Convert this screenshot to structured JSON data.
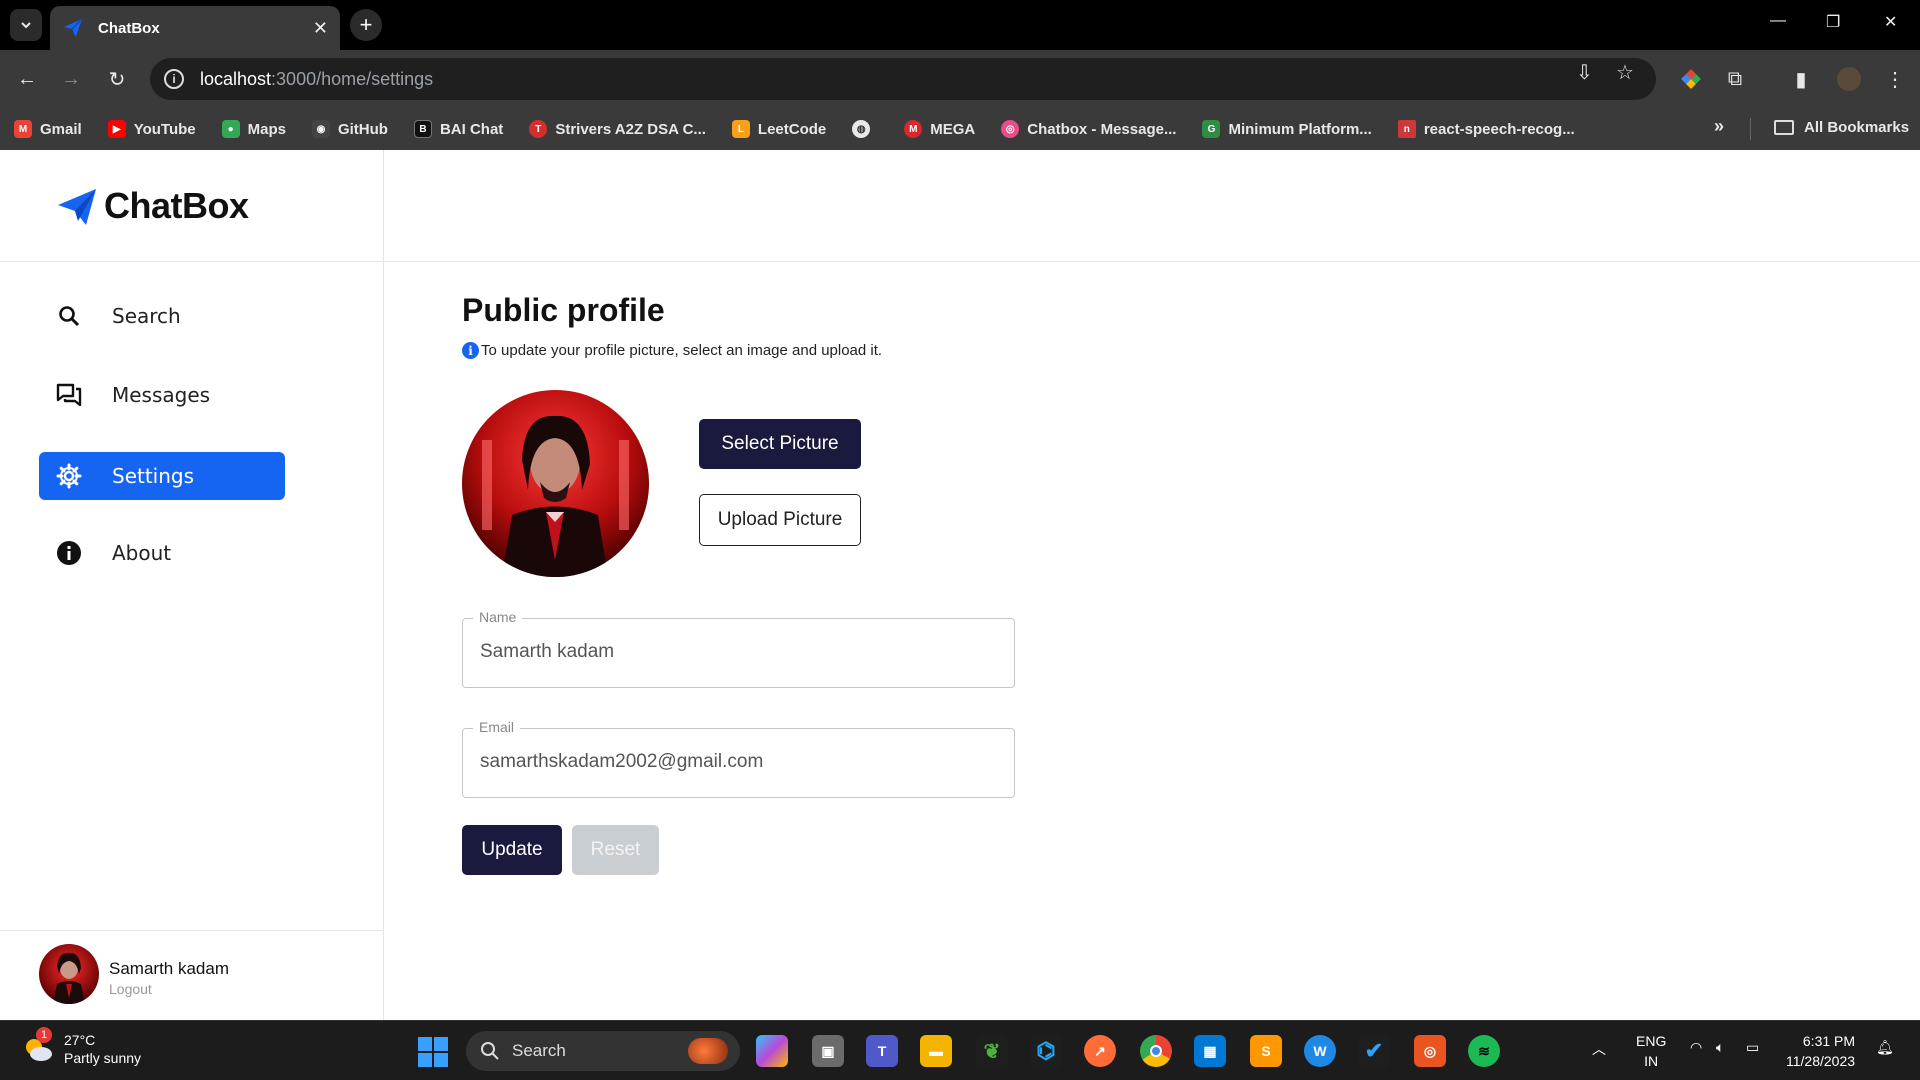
{
  "browser": {
    "tab_title": "ChatBox",
    "url_host": "localhost",
    "url_path": ":3000/home/settings",
    "bookmarks": [
      {
        "label": "Gmail",
        "icon": "gmail-icon",
        "color": "#ea4335",
        "glyph": "M"
      },
      {
        "label": "YouTube",
        "icon": "youtube-icon",
        "color": "#ff0000",
        "glyph": "▶"
      },
      {
        "label": "Maps",
        "icon": "maps-icon",
        "color": "#34a853",
        "glyph": "●"
      },
      {
        "label": "GitHub",
        "icon": "github-icon",
        "color": "#444444",
        "glyph": "◉"
      },
      {
        "label": "BAI Chat",
        "icon": "baichat-icon",
        "color": "#111111",
        "glyph": "B"
      },
      {
        "label": "Strivers A2Z DSA C...",
        "icon": "tuf-icon",
        "color": "#d32f2f",
        "glyph": "T"
      },
      {
        "label": "LeetCode",
        "icon": "leetcode-icon",
        "color": "#f89f1b",
        "glyph": "L"
      },
      {
        "label": "",
        "icon": "globe-icon",
        "color": "#555555",
        "glyph": "◍"
      },
      {
        "label": "MEGA",
        "icon": "mega-icon",
        "color": "#d9272e",
        "glyph": "M"
      },
      {
        "label": "Chatbox - Message...",
        "icon": "dribbble-icon",
        "color": "#ea4c89",
        "glyph": "◎"
      },
      {
        "label": "Minimum Platform...",
        "icon": "gfg-icon",
        "color": "#2f8d46",
        "glyph": "G"
      },
      {
        "label": "react-speech-recog...",
        "icon": "npm-icon",
        "color": "#cb3837",
        "glyph": "n"
      }
    ],
    "all_bookmarks": "All Bookmarks"
  },
  "app": {
    "logo_text": "ChatBox",
    "nav": {
      "search": "Search",
      "messages": "Messages",
      "settings": "Settings",
      "about": "About"
    },
    "user": {
      "name": "Samarth kadam",
      "logout": "Logout"
    },
    "accent_color": "#1565f2",
    "dark_button_color": "#1a1a3e"
  },
  "profile": {
    "title": "Public profile",
    "hint": "To update your profile picture, select an image and upload it.",
    "select_picture": "Select Picture",
    "upload_picture": "Upload Picture",
    "name_label": "Name",
    "name_value": "Samarth kadam",
    "email_label": "Email",
    "email_value": "samarthskadam2002@gmail.com",
    "update": "Update",
    "reset": "Reset"
  },
  "taskbar": {
    "weather_temp": "27°C",
    "weather_desc": "Partly sunny",
    "weather_badge": "1",
    "search": "Search",
    "lang_top": "ENG",
    "lang_bottom": "IN",
    "time": "6:31 PM",
    "date": "11/28/2023"
  }
}
